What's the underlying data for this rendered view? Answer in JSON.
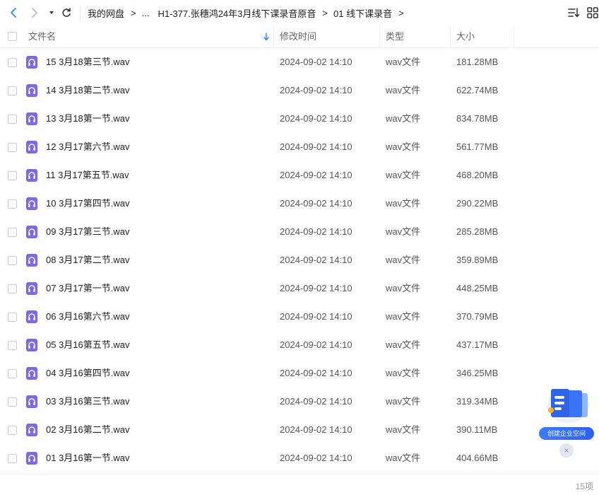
{
  "toolbar": {
    "back_icon": "chevron-left-icon",
    "forward_icon": "chevron-right-icon",
    "history_icon": "caret-down-icon",
    "refresh_icon": "refresh-icon",
    "sort_icon": "sort-list-icon",
    "grid_icon": "grid-view-icon"
  },
  "breadcrumb": {
    "items": [
      "我的网盘",
      "...",
      "H1-377.张穗鸿24年3月线下课录音原音",
      "01 线下课录音"
    ],
    "separator": ">"
  },
  "columns": {
    "name": "文件名",
    "time": "修改时间",
    "type": "类型",
    "size": "大小"
  },
  "files": [
    {
      "name": "15 3月18第三节.wav",
      "time": "2024-09-02 14:10",
      "type": "wav文件",
      "size": "181.28MB"
    },
    {
      "name": "14 3月18第二节.wav",
      "time": "2024-09-02 14:10",
      "type": "wav文件",
      "size": "622.74MB"
    },
    {
      "name": "13 3月18第一节.wav",
      "time": "2024-09-02 14:10",
      "type": "wav文件",
      "size": "834.78MB"
    },
    {
      "name": "12 3月17第六节.wav",
      "time": "2024-09-02 14:10",
      "type": "wav文件",
      "size": "561.77MB"
    },
    {
      "name": "11 3月17第五节.wav",
      "time": "2024-09-02 14:10",
      "type": "wav文件",
      "size": "468.20MB"
    },
    {
      "name": "10 3月17第四节.wav",
      "time": "2024-09-02 14:10",
      "type": "wav文件",
      "size": "290.22MB"
    },
    {
      "name": "09 3月17第三节.wav",
      "time": "2024-09-02 14:10",
      "type": "wav文件",
      "size": "285.28MB"
    },
    {
      "name": "08 3月17第二节.wav",
      "time": "2024-09-02 14:10",
      "type": "wav文件",
      "size": "359.89MB"
    },
    {
      "name": "07 3月17第一节.wav",
      "time": "2024-09-02 14:10",
      "type": "wav文件",
      "size": "448.25MB"
    },
    {
      "name": "06 3月16第六节.wav",
      "time": "2024-09-02 14:10",
      "type": "wav文件",
      "size": "370.79MB"
    },
    {
      "name": "05 3月16第五节.wav",
      "time": "2024-09-02 14:10",
      "type": "wav文件",
      "size": "437.17MB"
    },
    {
      "name": "04 3月16第四节.wav",
      "time": "2024-09-02 14:10",
      "type": "wav文件",
      "size": "346.25MB"
    },
    {
      "name": "03 3月16第三节.wav",
      "time": "2024-09-02 14:10",
      "type": "wav文件",
      "size": "319.34MB"
    },
    {
      "name": "02 3月16第二节.wav",
      "time": "2024-09-02 14:10",
      "type": "wav文件",
      "size": "390.11MB"
    },
    {
      "name": "01 3月16第一节.wav",
      "time": "2024-09-02 14:10",
      "type": "wav文件",
      "size": "404.66MB"
    }
  ],
  "file_icon": "audio-file-icon",
  "footer": {
    "count": "15项"
  },
  "enterprise": {
    "label": "创建企业空间",
    "close": "×"
  },
  "colors": {
    "accent": "#1e90ff",
    "file_icon": "#7b68ee",
    "enterprise": "#3e7bff"
  }
}
